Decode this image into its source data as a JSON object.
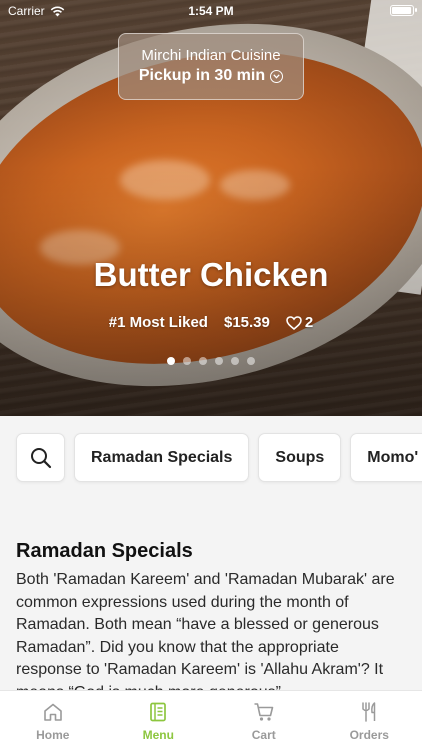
{
  "status_bar": {
    "carrier": "Carrier",
    "time": "1:54 PM",
    "battery_level": 1.0
  },
  "pickup": {
    "restaurant": "Mirchi Indian Cuisine",
    "pickup_text": "Pickup in 30 min",
    "icon": "chevron-down-circle-icon"
  },
  "featured": {
    "title": "Butter Chicken",
    "rank": "#1 Most Liked",
    "price": "$15.39",
    "likes": "2",
    "slide_count": 6,
    "active_slide": 1
  },
  "categories": [
    "Ramadan Specials",
    "Soups",
    "Momo'"
  ],
  "section": {
    "title": "Ramadan Specials",
    "description": "Both 'Ramadan Kareem' and 'Ramadan Mubarak' are common expressions used during the month of Ramadan. Both mean “have a blessed or generous Ramadan”. Did you know that the appropriate response to 'Ramadan Kareem' is 'Allahu Akram'? It means “God is much more generous”."
  },
  "tabs": [
    {
      "label": "Home",
      "icon": "home-icon",
      "active": false
    },
    {
      "label": "Menu",
      "icon": "menu-icon",
      "active": true
    },
    {
      "label": "Cart",
      "icon": "cart-icon",
      "active": false
    },
    {
      "label": "Orders",
      "icon": "utensils-icon",
      "active": false
    }
  ],
  "colors": {
    "accent": "#8dc63f",
    "inactive_tab": "#9a9a9a"
  }
}
